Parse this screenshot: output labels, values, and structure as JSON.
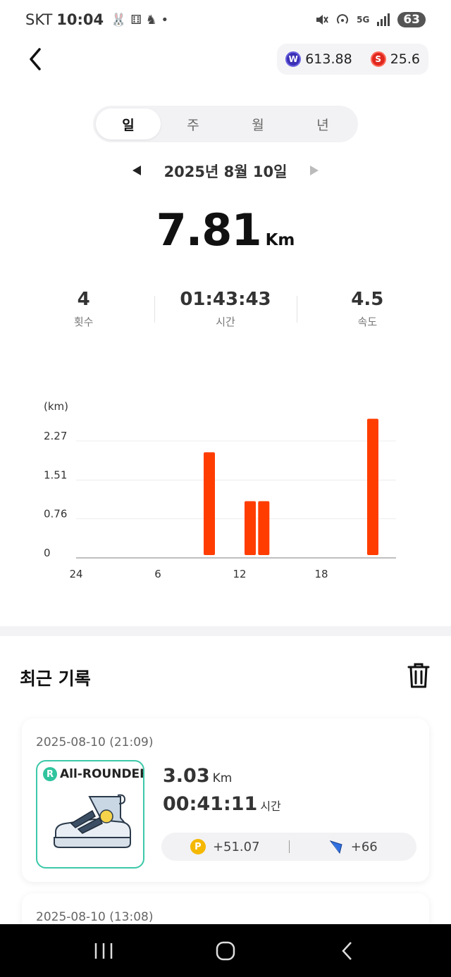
{
  "status_bar": {
    "carrier": "SKT",
    "time": "10:04",
    "notification_icons": "🐰 ⚅ ♞ •",
    "network": "5G",
    "battery": "63"
  },
  "header": {
    "wallet": {
      "w_coin_value": "613.88",
      "s_coin_value": "25.6"
    }
  },
  "tabs": [
    {
      "label": "일",
      "active": true
    },
    {
      "label": "주",
      "active": false
    },
    {
      "label": "월",
      "active": false
    },
    {
      "label": "년",
      "active": false
    }
  ],
  "date_nav": {
    "label": "2025년 8월 10일"
  },
  "summary": {
    "distance": "7.81",
    "distance_unit": "Km",
    "stats": [
      {
        "value": "4",
        "label": "횟수"
      },
      {
        "value": "01:43:43",
        "label": "시간"
      },
      {
        "value": "4.5",
        "label": "속도"
      }
    ]
  },
  "chart_data": {
    "type": "bar",
    "ylabel": "(km)",
    "y_ticks": [
      "0",
      "0.76",
      "1.51",
      "2.27"
    ],
    "x_ticks": [
      {
        "label": "24",
        "hour": 0
      },
      {
        "label": "6",
        "hour": 6
      },
      {
        "label": "12",
        "hour": 12
      },
      {
        "label": "18",
        "hour": 18
      }
    ],
    "ylim": [
      0,
      2.27
    ],
    "x_range": [
      0,
      24
    ],
    "bars": [
      {
        "hour": 9,
        "value": 2.05
      },
      {
        "hour": 12,
        "value": 1.1
      },
      {
        "hour": 13,
        "value": 1.1
      },
      {
        "hour": 21,
        "value": 2.7
      }
    ],
    "bar_color": "#ff3d00",
    "grid": true
  },
  "recent": {
    "title": "최근 기록",
    "records": [
      {
        "date": "2025-08-10 (21:09)",
        "shoe_badge": "R",
        "shoe_type": "All-ROUNDER",
        "distance": "3.03",
        "distance_unit": "Km",
        "duration": "00:41:11",
        "duration_unit": "시간",
        "reward_points": "+51.07",
        "reward_gems": "+66"
      },
      {
        "date": "2025-08-10 (13:08)"
      }
    ]
  },
  "colors": {
    "accent_bar": "#ff3d00",
    "shoe_border": "#3cc8a8",
    "point_coin": "#f5b800"
  }
}
